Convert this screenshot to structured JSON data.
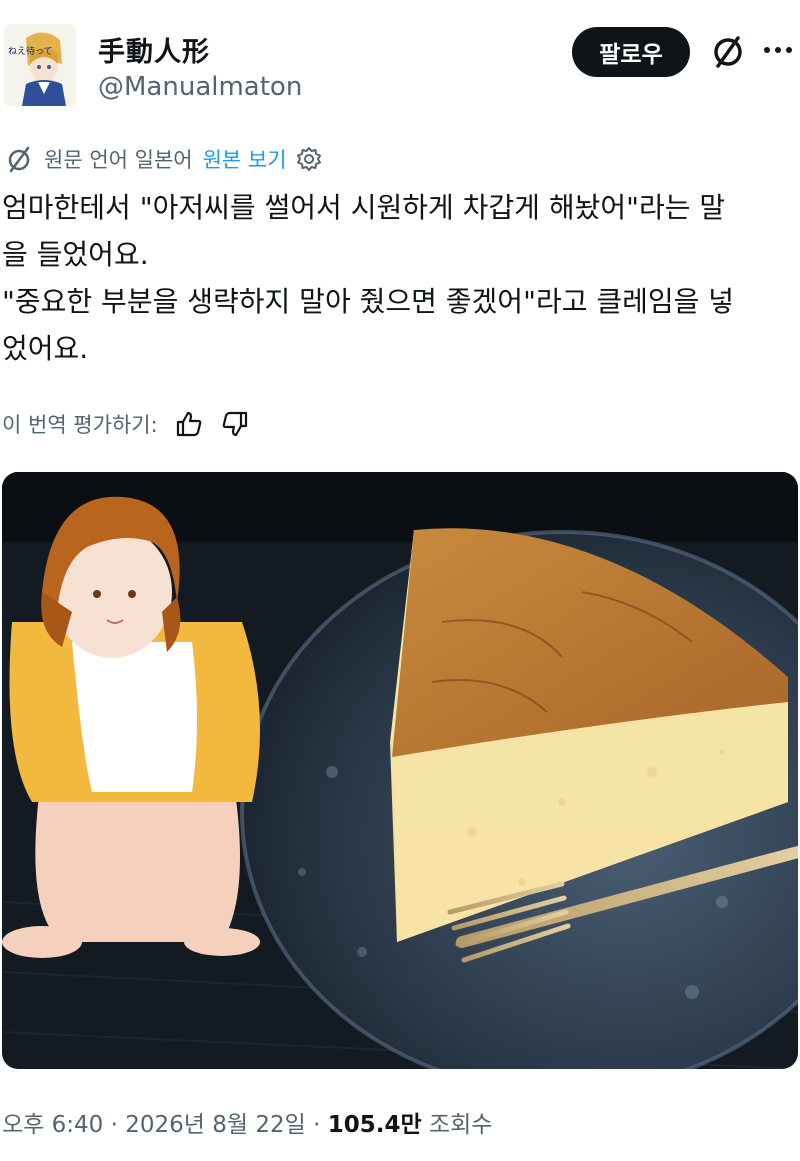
{
  "header": {
    "name": "手動人形",
    "handle": "@Manualmaton",
    "follow_label": "팔로우",
    "avatar_text": "ねえ待って",
    "icons": {
      "grok": "slash-circle-icon",
      "more": "more-horizontal-icon"
    }
  },
  "translation": {
    "source_text": "원문 언어 일본어",
    "show_original": "원본 보기",
    "icon": "translate-icon",
    "settings_icon": "gear-icon"
  },
  "post": {
    "lines": [
      "엄마한테서 \"아저씨를 썰어서 시원하게 차갑게 해놨어\"라는 말",
      "을 들었어요.",
      "\"중요한 부분을 생략하지 말아 줬으면 좋겠어\"라고 클레임을 넣",
      "었어요."
    ]
  },
  "rating": {
    "label": "이 번역 평가하기:",
    "up_icon": "thumbs-up-icon",
    "down_icon": "thumbs-down-icon"
  },
  "photo": {
    "subject": "figure-and-cheesecake-photo"
  },
  "meta": {
    "time": "오후 6:40",
    "separator": "·",
    "date": "2026년 8월 22일",
    "views_count": "105.4만",
    "views_label": "조회수"
  },
  "colors": {
    "text": "#0f1419",
    "secondary": "#536471",
    "link": "#1d9bf0",
    "button_bg": "#0f1419"
  }
}
